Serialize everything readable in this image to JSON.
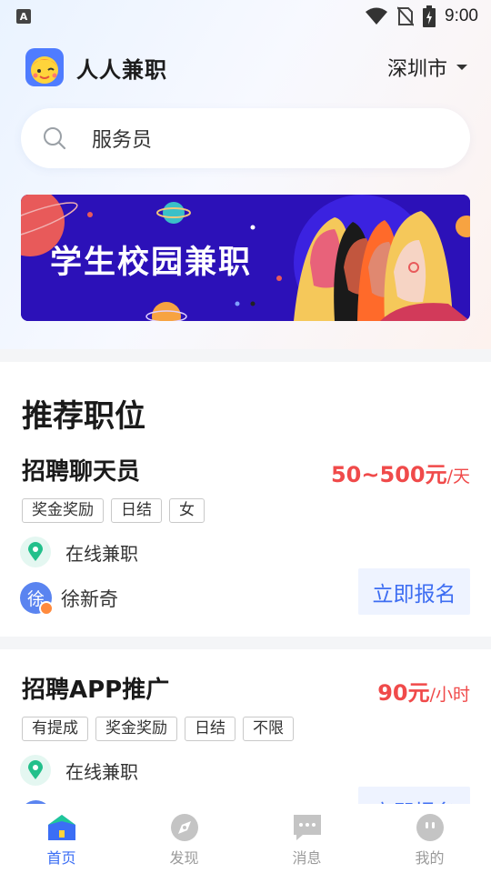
{
  "status_bar": {
    "time": "9:00",
    "left_icon_letter": "A"
  },
  "header": {
    "app_name": "人人兼职",
    "city": "深圳市"
  },
  "search": {
    "text": "服务员"
  },
  "banner": {
    "title": "学生校园兼职"
  },
  "section": {
    "title": "推荐职位"
  },
  "jobs": [
    {
      "title": "招聘聊天员",
      "salary": "50~500元",
      "salary_unit": "/天",
      "tags": [
        "奖金奖励",
        "日结",
        "女"
      ],
      "location": "在线兼职",
      "publisher": "徐新奇",
      "publisher_avatar_char": "徐",
      "apply_label": "立即报名"
    },
    {
      "title": "招聘APP推广",
      "salary": "90元",
      "salary_unit": "/小时",
      "tags": [
        "有提成",
        "奖金奖励",
        "日结",
        "不限"
      ],
      "location": "在线兼职",
      "apply_label": "立即报名"
    }
  ],
  "tabbar": {
    "tabs": [
      {
        "label": "首页",
        "icon": "home-icon",
        "active": true
      },
      {
        "label": "发现",
        "icon": "compass-icon",
        "active": false
      },
      {
        "label": "消息",
        "icon": "message-icon",
        "active": false
      },
      {
        "label": "我的",
        "icon": "profile-icon",
        "active": false
      }
    ]
  },
  "colors": {
    "accent": "#3b6ef5",
    "salary": "#f04a4a",
    "banner_bg": "#2c11b8"
  }
}
